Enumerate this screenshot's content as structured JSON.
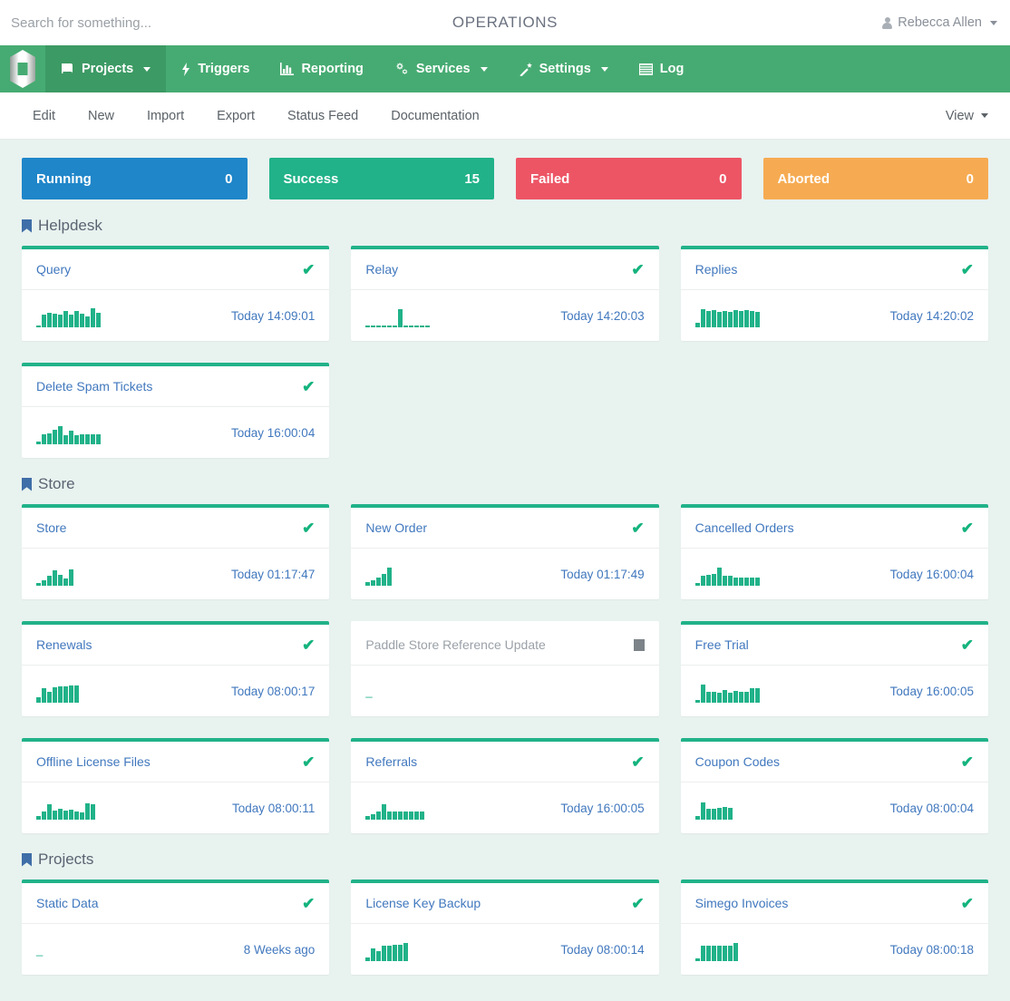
{
  "header": {
    "search_placeholder": "Search for something...",
    "search_value": "",
    "title": "OPERATIONS",
    "user_name": "Rebecca Allen",
    "user_icon": "user-icon",
    "caret_icon": "chevron-down-icon"
  },
  "navbar": {
    "logo_icon": "simego-logo-icon",
    "items": [
      {
        "label": "Projects",
        "icon": "book-icon",
        "caret": true,
        "active": true
      },
      {
        "label": "Triggers",
        "icon": "bolt-icon",
        "caret": false,
        "active": false
      },
      {
        "label": "Reporting",
        "icon": "bar-chart-icon",
        "caret": false,
        "active": false
      },
      {
        "label": "Services",
        "icon": "gears-icon",
        "caret": true,
        "active": false
      },
      {
        "label": "Settings",
        "icon": "magic-wand-icon",
        "caret": true,
        "active": false
      },
      {
        "label": "Log",
        "icon": "list-icon",
        "caret": false,
        "active": false
      }
    ]
  },
  "subbar": {
    "items": [
      {
        "label": "Edit"
      },
      {
        "label": "New"
      },
      {
        "label": "Import"
      },
      {
        "label": "Export"
      },
      {
        "label": "Status Feed"
      },
      {
        "label": "Documentation"
      }
    ],
    "view_label": "View",
    "view_caret_icon": "chevron-down-icon"
  },
  "stats": [
    {
      "label": "Running",
      "value": "0",
      "color": "#1f86c9"
    },
    {
      "label": "Success",
      "value": "15",
      "color": "#21b289"
    },
    {
      "label": "Failed",
      "value": "0",
      "color": "#ed5565"
    },
    {
      "label": "Aborted",
      "value": "0",
      "color": "#f6ab52"
    }
  ],
  "sections": [
    {
      "name": "Helpdesk",
      "icon": "bookmark-icon",
      "cards": [
        {
          "title": "Query",
          "status": "success",
          "status_icon": "check-icon",
          "timestamp": "Today 14:09:01",
          "spark": [
            2,
            14,
            16,
            15,
            14,
            18,
            14,
            18,
            15,
            12,
            21,
            16
          ]
        },
        {
          "title": "Relay",
          "status": "success",
          "status_icon": "check-icon",
          "timestamp": "Today 14:20:03",
          "spark": [
            2,
            2,
            2,
            2,
            2,
            2,
            20,
            2,
            2,
            2,
            2,
            2
          ]
        },
        {
          "title": "Replies",
          "status": "success",
          "status_icon": "check-icon",
          "timestamp": "Today 14:20:02",
          "spark": [
            5,
            20,
            18,
            19,
            17,
            18,
            17,
            19,
            18,
            19,
            18,
            17
          ]
        },
        {
          "title": "Delete Spam Tickets",
          "status": "success",
          "status_icon": "check-icon",
          "timestamp": "Today 16:00:04",
          "spark": [
            3,
            11,
            12,
            16,
            20,
            10,
            15,
            10,
            11,
            11,
            11,
            11
          ]
        }
      ]
    },
    {
      "name": "Store",
      "icon": "bookmark-icon",
      "cards": [
        {
          "title": "Store",
          "status": "success",
          "status_icon": "check-icon",
          "timestamp": "Today 01:17:47",
          "spark": [
            3,
            6,
            11,
            17,
            12,
            8,
            18
          ]
        },
        {
          "title": "New Order",
          "status": "success",
          "status_icon": "check-icon",
          "timestamp": "Today 01:17:49",
          "spark": [
            4,
            6,
            9,
            13,
            20
          ]
        },
        {
          "title": "Cancelled Orders",
          "status": "success",
          "status_icon": "check-icon",
          "timestamp": "Today 16:00:04",
          "spark": [
            3,
            11,
            12,
            13,
            20,
            11,
            11,
            9,
            9,
            9,
            9,
            9
          ]
        },
        {
          "title": "Renewals",
          "status": "success",
          "status_icon": "check-icon",
          "timestamp": "Today 08:00:17",
          "spark": [
            6,
            16,
            12,
            17,
            18,
            18,
            19,
            19
          ]
        },
        {
          "title": "Paddle Store Reference Update",
          "status": "inactive",
          "status_icon": "stop-icon",
          "timestamp": "",
          "spark": []
        },
        {
          "title": "Free Trial",
          "status": "success",
          "status_icon": "check-icon",
          "timestamp": "Today 16:00:05",
          "spark": [
            3,
            20,
            12,
            12,
            11,
            14,
            11,
            13,
            12,
            12,
            16,
            16
          ]
        },
        {
          "title": "Offline License Files",
          "status": "success",
          "status_icon": "check-icon",
          "timestamp": "Today 08:00:11",
          "spark": [
            4,
            9,
            17,
            10,
            12,
            10,
            11,
            9,
            8,
            18,
            17
          ]
        },
        {
          "title": "Referrals",
          "status": "success",
          "status_icon": "check-icon",
          "timestamp": "Today 16:00:05",
          "spark": [
            4,
            6,
            9,
            17,
            9,
            9,
            9,
            9,
            9,
            9,
            9
          ]
        },
        {
          "title": "Coupon Codes",
          "status": "success",
          "status_icon": "check-icon",
          "timestamp": "Today 08:00:04",
          "spark": [
            4,
            19,
            12,
            12,
            13,
            14,
            13
          ]
        }
      ]
    },
    {
      "name": "Projects",
      "icon": "bookmark-icon",
      "cards": [
        {
          "title": "Static Data",
          "status": "success",
          "status_icon": "check-icon",
          "timestamp": "8 Weeks ago",
          "spark": []
        },
        {
          "title": "License Key Backup",
          "status": "success",
          "status_icon": "check-icon",
          "timestamp": "Today 08:00:14",
          "spark": [
            4,
            14,
            11,
            17,
            17,
            18,
            18,
            20
          ]
        },
        {
          "title": "Simego Invoices",
          "status": "success",
          "status_icon": "check-icon",
          "timestamp": "Today 08:00:18",
          "spark": [
            3,
            17,
            17,
            17,
            17,
            17,
            17,
            20
          ]
        }
      ]
    }
  ]
}
